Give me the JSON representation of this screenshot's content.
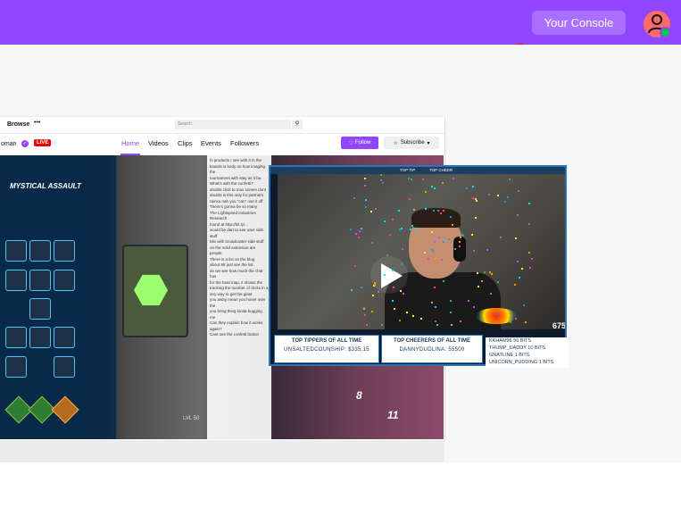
{
  "topbar": {
    "console_label": "Your Console",
    "color": "#9146ff"
  },
  "twitch": {
    "nav_browse": "Browse",
    "nav_more": "•••",
    "search_placeholder": "Search",
    "channel_name": "oman",
    "live_label": "LIVE",
    "tabs": [
      {
        "label": "Home",
        "active": true
      },
      {
        "label": "Videos"
      },
      {
        "label": "Clips"
      },
      {
        "label": "Events"
      },
      {
        "label": "Followers"
      }
    ],
    "follow_label": "Follow",
    "subscribe_label": "Subscribe"
  },
  "game": {
    "hud_title": "MYSTICAL ASSAULT",
    "num1": "8",
    "num2": "11",
    "level_text": "LVL 50"
  },
  "overlay": {
    "header_items": [
      "TOP TIP",
      "TOP CHEER"
    ],
    "view_count": "675",
    "tippers_title": "TOP TIPPERS OF ALL TIME",
    "tippers_value": "UNSALTEDCOUNSHIP: $335.15",
    "cheerers_title": "TOP CHEERERS OF ALL TIME",
    "cheerers_value": "DANNYDUDLINA: 55500",
    "bits": [
      "KKHAM96 56 BITS",
      "THUMP_DADDY 10 BITS",
      "GNATLINE 1 BITS",
      "UNICORN_PUDDING 1 BITS"
    ]
  },
  "chat_lines": [
    "hi products I see with it in the",
    "boards is body on how imaging the",
    "tournament with stay as it be.",
    "What's with the confetti?",
    "double click to max screen dont",
    "doubts is this only for partners",
    "rainsu nah you \"can\" use it off",
    "There's gonna be so many",
    "The Lightspeed Industries Research",
    "found at http://bit.ly/...",
    "would be dart to see user side stuff",
    "Mix with broadcaster side stuff",
    "on the solid extension are people",
    "There is a list on the blog",
    "about 98 just see the list",
    "do we see how much the chat has",
    "for the heat map, it shows the",
    "tracking the number of clicks in a",
    "any way to get the giant",
    "you away mean you hover over the",
    "you bring thing kinda bugging me",
    "Can they explain how it works again?",
    "Cant see the confetti button"
  ]
}
